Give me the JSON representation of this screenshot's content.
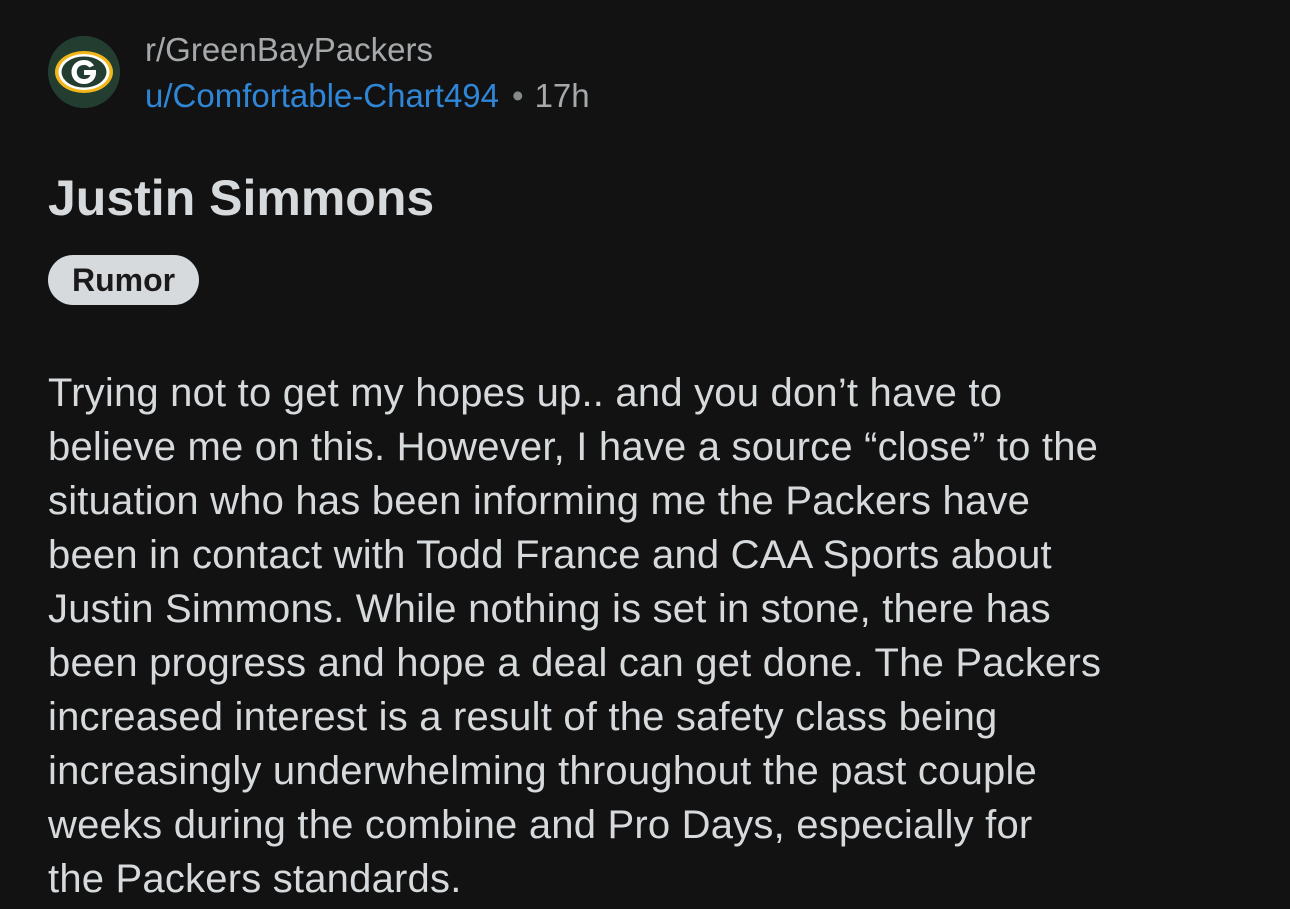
{
  "post": {
    "subreddit": "r/GreenBayPackers",
    "author": "u/Comfortable-Chart494",
    "separator": "•",
    "age": "17h",
    "avatar_icon": "green-bay-packers-g-logo",
    "title": "Justin Simmons",
    "flair": "Rumor",
    "body_lines": [
      "Trying not to get my hopes up.. and you don’t have to",
      "believe me on this. However, I have a source “close” to the",
      "situation who has been informing me the Packers have",
      "been in contact with Todd France and CAA Sports about",
      "Justin Simmons. While nothing is set in stone, there has",
      "been progress and hope a deal can get done. The Packers",
      "increased interest is a result of the safety class being",
      "increasingly underwhelming throughout the past couple",
      "weeks during the combine and Pro Days,  especially for",
      "the Packers standards."
    ]
  },
  "colors": {
    "background": "#121212",
    "text_primary": "#d7dadc",
    "text_secondary": "#a6a9ab",
    "username_link": "#2f86d6",
    "flair_background": "#d7dadc",
    "logo_green": "#233d30",
    "logo_gold": "#f3b619"
  }
}
